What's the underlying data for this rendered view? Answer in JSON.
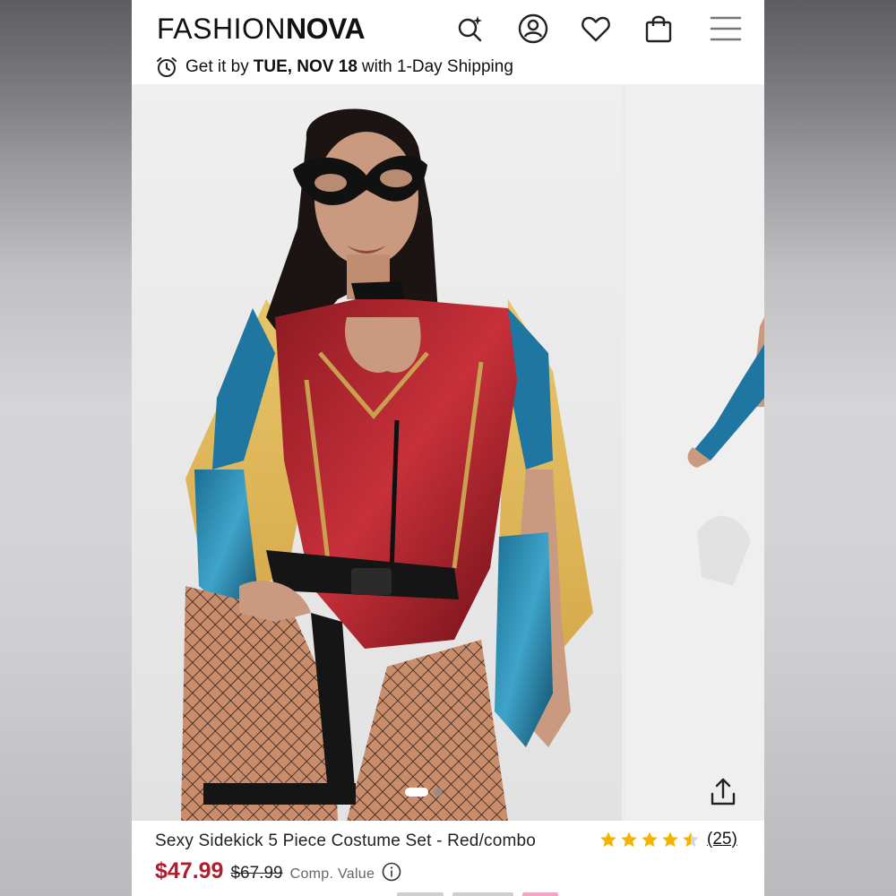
{
  "brand": {
    "logo_light": "FASHION",
    "logo_bold": "NOVA"
  },
  "header": {
    "icons": [
      "search-sparkle-icon",
      "account-icon",
      "heart-icon",
      "bag-icon",
      "menu-icon"
    ]
  },
  "shipping": {
    "prefix": "Get it by",
    "date": "TUE, NOV 18",
    "suffix": "with 1-Day Shipping"
  },
  "gallery": {
    "active_index": 1,
    "total": 2
  },
  "product": {
    "title": "Sexy Sidekick 5 Piece Costume Set - Red/combo",
    "rating": 4.5,
    "review_count": "(25)",
    "price_sale": "$47.99",
    "price_original": "$67.99",
    "comp_value_label": "Comp. Value"
  },
  "colors": {
    "sale_red": "#b01d2e",
    "star_gold": "#f5b301",
    "text_dark": "#111111"
  }
}
